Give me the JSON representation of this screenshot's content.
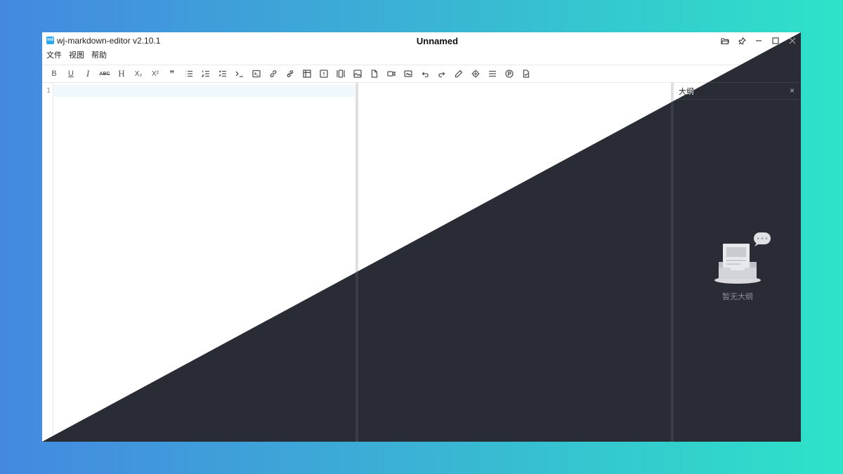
{
  "app": {
    "name": "wj-markdown-editor v2.10.1",
    "logo_text": "md"
  },
  "document": {
    "title": "Unnamed"
  },
  "window_controls": [
    {
      "icon": "folder-icon",
      "glyph": "🗀"
    },
    {
      "icon": "pin-icon",
      "glyph": "✎"
    },
    {
      "icon": "minimize-icon",
      "glyph": "–"
    },
    {
      "icon": "maximize-icon",
      "glyph": "☐"
    },
    {
      "icon": "close-icon",
      "glyph": "×"
    }
  ],
  "menu": [
    "文件",
    "视图",
    "帮助"
  ],
  "toolbar": {
    "bold": "B",
    "underline": "U",
    "italic": "I",
    "strike": "ABC",
    "heading": "H",
    "subscript": "X₂",
    "superscript": "X²",
    "quote": "❞"
  },
  "editor": {
    "line_number": "1"
  },
  "outline": {
    "title": "大纲",
    "close": "×",
    "empty_text": "暂无大纲"
  }
}
